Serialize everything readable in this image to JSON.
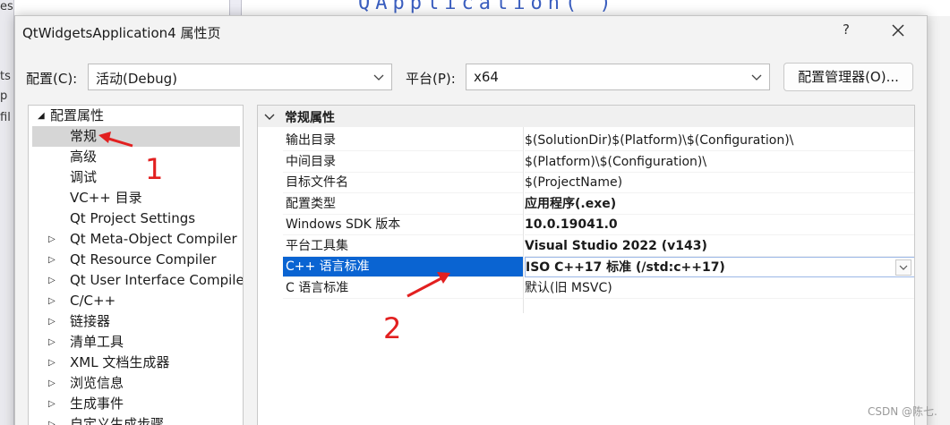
{
  "background": {
    "left_texts": [
      "es",
      "ts",
      "p",
      "fil"
    ],
    "code_snippet": "QApplication(     )"
  },
  "dialog": {
    "title": "QtWidgetsApplication4 属性页",
    "help": "?"
  },
  "toolbar": {
    "config_label": "配置(C):",
    "config_value": "活动(Debug)",
    "platform_label": "平台(P):",
    "platform_value": "x64",
    "config_manager": "配置管理器(O)..."
  },
  "tree": {
    "root": "配置属性",
    "items": [
      {
        "label": "常规",
        "expandable": false,
        "selected": true
      },
      {
        "label": "高级",
        "expandable": false
      },
      {
        "label": "调试",
        "expandable": false
      },
      {
        "label": "VC++ 目录",
        "expandable": false
      },
      {
        "label": "Qt Project Settings",
        "expandable": false
      },
      {
        "label": "Qt Meta-Object Compiler",
        "expandable": true
      },
      {
        "label": "Qt Resource Compiler",
        "expandable": true
      },
      {
        "label": "Qt User Interface Compiler",
        "expandable": true
      },
      {
        "label": "C/C++",
        "expandable": true
      },
      {
        "label": "链接器",
        "expandable": true
      },
      {
        "label": "清单工具",
        "expandable": true
      },
      {
        "label": "XML 文档生成器",
        "expandable": true
      },
      {
        "label": "浏览信息",
        "expandable": true
      },
      {
        "label": "生成事件",
        "expandable": true
      },
      {
        "label": "自定义生成步骤",
        "expandable": true
      }
    ]
  },
  "grid": {
    "section": "常规属性",
    "rows": [
      {
        "name": "输出目录",
        "value": "$(SolutionDir)$(Platform)\\$(Configuration)\\",
        "bold": false
      },
      {
        "name": "中间目录",
        "value": "$(Platform)\\$(Configuration)\\",
        "bold": false
      },
      {
        "name": "目标文件名",
        "value": "$(ProjectName)",
        "bold": false
      },
      {
        "name": "配置类型",
        "value": "应用程序(.exe)",
        "bold": true
      },
      {
        "name": "Windows SDK 版本",
        "value": "10.0.19041.0",
        "bold": true
      },
      {
        "name": "平台工具集",
        "value": "Visual Studio 2022 (v143)",
        "bold": true
      },
      {
        "name": "C++ 语言标准",
        "value": "ISO C++17 标准 (/std:c++17)",
        "bold": true,
        "selected": true
      },
      {
        "name": "C 语言标准",
        "value": "默认(旧 MSVC)",
        "bold": false
      }
    ]
  },
  "annotations": {
    "one": "1",
    "two": "2",
    "color": "#e22020"
  },
  "watermark": "CSDN @陈七."
}
